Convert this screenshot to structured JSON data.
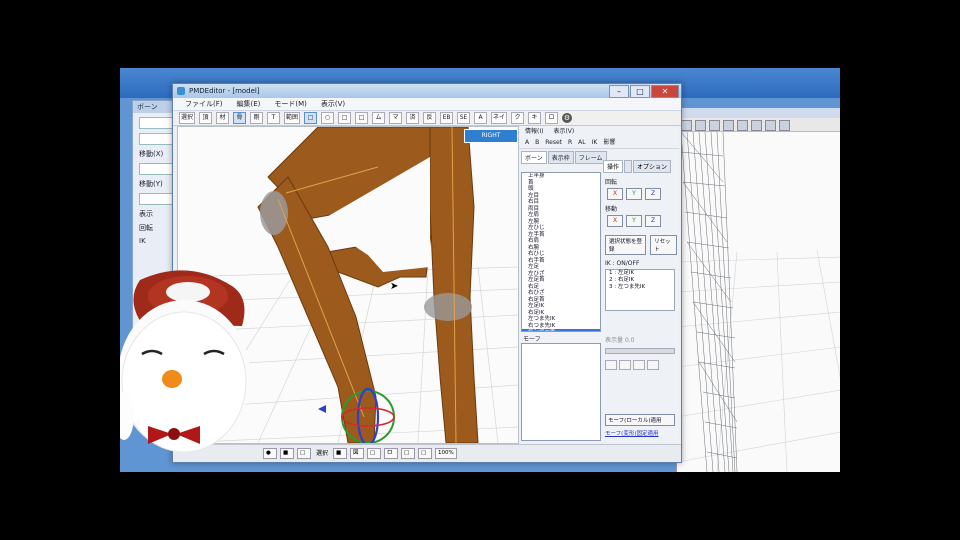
{
  "main_window": {
    "title": "PMDEditor - [model]",
    "menu": [
      "ファイル(F)",
      "編集(E)",
      "モード(M)",
      "表示(V)"
    ],
    "toolbar": [
      "選択",
      "頂",
      "材",
      "骨",
      "剛",
      "T",
      "範囲",
      "□",
      "○",
      "□",
      "□",
      "ム",
      "マ",
      "済",
      "反",
      "EB",
      "SE",
      "A",
      "ネイ",
      "ク",
      "キ",
      "ロ"
    ],
    "close_label": "✕",
    "view_cube_label": "RIGHT",
    "status_items": [
      "●",
      "■",
      "□",
      "選択",
      "■",
      "図",
      "□",
      "ロ",
      "□",
      "□",
      "100%"
    ]
  },
  "side_panel": {
    "menu": [
      "情報(I)",
      "表示(V)"
    ],
    "row": [
      "A",
      "B",
      "Reset",
      "R",
      "AL",
      "IK",
      "影響"
    ],
    "tabs": [
      "ボーン",
      "表示枠",
      "フレーム"
    ],
    "bone_items": [
      "上半身",
      "首",
      "頭",
      "左目",
      "右目",
      "両目",
      "左肩",
      "左腕",
      "左ひじ",
      "左手首",
      "右肩",
      "右腕",
      "右ひじ",
      "右手首",
      "左足",
      "左ひざ",
      "左足首",
      "右足",
      "右ひざ",
      "右足首",
      "左足IK",
      "右足IK",
      "左つま先IK",
      "右つま先IK",
      "センター先"
    ],
    "selected_bone_index": 24,
    "morph_label": "モーフ",
    "control_tabs": [
      "操作",
      "",
      "オプション"
    ],
    "rotate_label": "回転",
    "move_label": "移動",
    "x": "X",
    "y": "Y",
    "z": "Z",
    "reg_btn": "選択状態を登録",
    "link_btn": "リセット",
    "onoff_label": "IK : ON/OFF",
    "ik_items": [
      "1 : 左足IK",
      "2 : 右足IK",
      "3 : 左つま先IK"
    ],
    "slider_label": "表示量",
    "slider_value": "0.0",
    "bottom_button": "モーフ(ローカル)適用",
    "bottom_link": "モーフ(変形)固定適用"
  },
  "bg_left": {
    "title": "ボーン",
    "labels": [
      "移動(X)",
      "移動(Y)",
      "表示",
      "回転",
      "IK"
    ]
  },
  "colors": {
    "leg": "#9c5a1c",
    "grid": "#d4d4d4",
    "accent": "#3a73d9"
  }
}
